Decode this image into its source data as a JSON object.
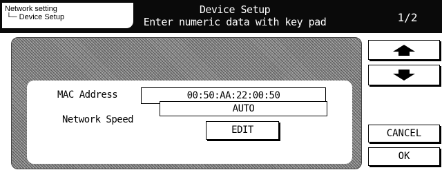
{
  "header": {
    "breadcrumb": {
      "parent": "Network setting",
      "child": "└─ Device Setup"
    },
    "title": "Device Setup",
    "instruction": "Enter numeric data with key pad",
    "page": "1/2"
  },
  "settings": {
    "mac_label": "MAC Address",
    "mac_value": "00:50:AA:22:00:50",
    "speed_label": "Network Speed",
    "speed_value": "AUTO",
    "edit_label": "EDIT"
  },
  "side": {
    "up_icon": "up-arrow-icon",
    "down_icon": "down-arrow-icon",
    "cancel_label": "CANCEL",
    "ok_label": "OK"
  }
}
